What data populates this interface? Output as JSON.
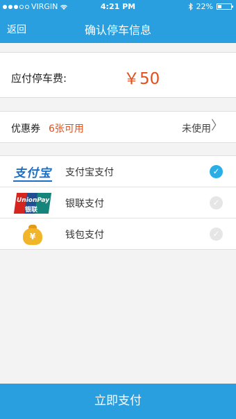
{
  "status_bar": {
    "carrier": "VIRGIN",
    "time": "4:21 PM",
    "battery": "22%"
  },
  "nav": {
    "back_label": "返回",
    "title": "确认停车信息"
  },
  "fee": {
    "label": "应付停车费:",
    "amount": "￥50"
  },
  "coupon": {
    "label": "优惠券",
    "count": "6张可用",
    "status": "未使用",
    "chevron": "〉"
  },
  "payments": [
    {
      "name": "支付宝支付",
      "logo_text": "支付宝",
      "selected": true
    },
    {
      "name": "银联支付",
      "logo_text": "UnionPay",
      "logo_text2": "银联",
      "selected": false
    },
    {
      "name": "钱包支付",
      "logo_text": "¥",
      "selected": false
    }
  ],
  "check_glyph": "✓",
  "pay_button": "立即支付",
  "colors": {
    "brand": "#2a9fe0",
    "accent": "#e0501d",
    "check_on": "#2aaee8",
    "check_off": "#e6e6e6"
  }
}
